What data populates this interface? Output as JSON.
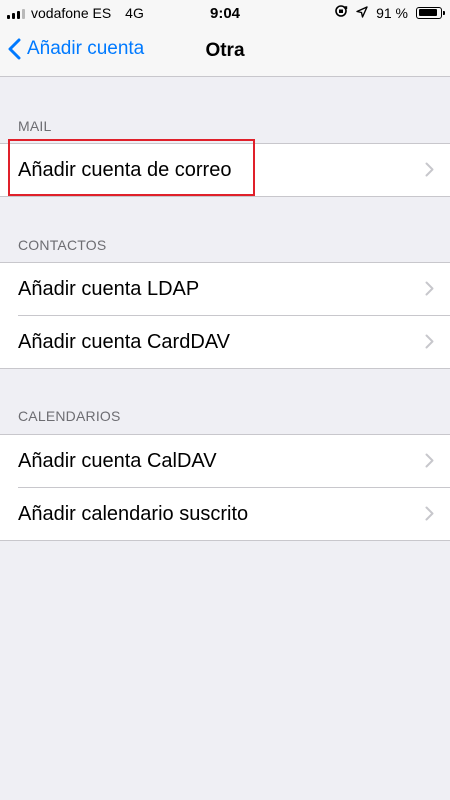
{
  "status_bar": {
    "carrier": "vodafone ES",
    "network": "4G",
    "time": "9:04",
    "battery_percent": "91 %",
    "battery_level": 0.91,
    "icons": [
      "signal-icon",
      "orientation-lock-icon",
      "location-icon",
      "battery-icon"
    ]
  },
  "nav": {
    "back_label": "Añadir cuenta",
    "title": "Otra"
  },
  "sections": {
    "mail": {
      "header": "MAIL",
      "items": [
        {
          "label": "Añadir cuenta de correo"
        }
      ]
    },
    "contacts": {
      "header": "CONTACTOS",
      "items": [
        {
          "label": "Añadir cuenta LDAP"
        },
        {
          "label": "Añadir cuenta CardDAV"
        }
      ]
    },
    "calendars": {
      "header": "CALENDARIOS",
      "items": [
        {
          "label": "Añadir cuenta CalDAV"
        },
        {
          "label": "Añadir calendario suscrito"
        }
      ]
    }
  },
  "colors": {
    "accent": "#007aff",
    "highlight": "#e0202a",
    "background": "#efeff4"
  }
}
